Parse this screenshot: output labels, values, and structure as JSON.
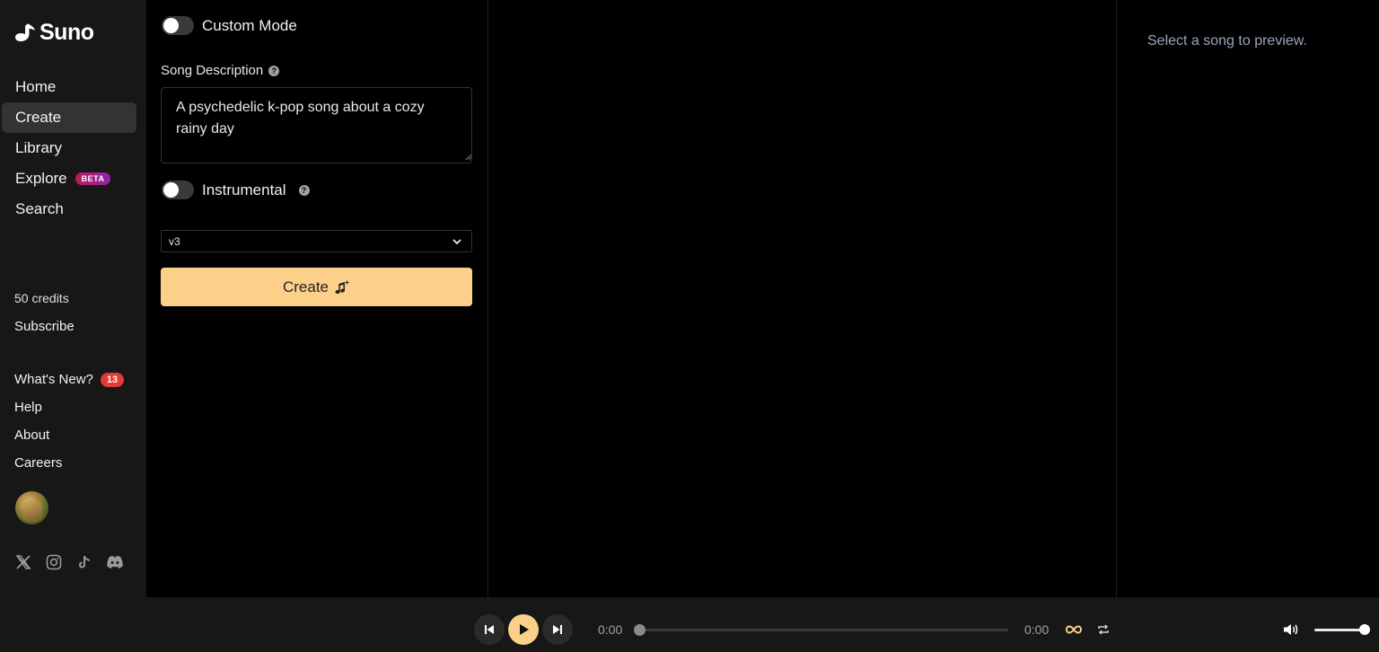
{
  "brand": {
    "name": "Suno"
  },
  "sidebar": {
    "nav": [
      {
        "label": "Home",
        "name": "home"
      },
      {
        "label": "Create",
        "name": "create",
        "active": true
      },
      {
        "label": "Library",
        "name": "library"
      },
      {
        "label": "Explore",
        "name": "explore",
        "badge": "BETA"
      },
      {
        "label": "Search",
        "name": "search"
      }
    ],
    "credits": "50 credits",
    "subscribe": "Subscribe",
    "links": [
      {
        "label": "What's New?",
        "badge": "13"
      },
      {
        "label": "Help"
      },
      {
        "label": "About"
      },
      {
        "label": "Careers"
      }
    ],
    "socials": [
      "x-icon",
      "instagram-icon",
      "tiktok-icon",
      "discord-icon"
    ]
  },
  "create_panel": {
    "custom_mode_label": "Custom Mode",
    "custom_mode_on": false,
    "description_label": "Song Description",
    "description_value": "A psychedelic k-pop song about a cozy rainy day",
    "instrumental_label": "Instrumental",
    "instrumental_on": false,
    "model_value": "v3",
    "create_label": "Create"
  },
  "preview": {
    "placeholder": "Select a song to preview."
  },
  "player": {
    "current_time": "0:00",
    "duration": "0:00",
    "progress": 0,
    "volume": 1.0
  },
  "colors": {
    "accent": "#fdd08a",
    "sidebar_bg": "#171717",
    "badge_red": "#e53935"
  }
}
